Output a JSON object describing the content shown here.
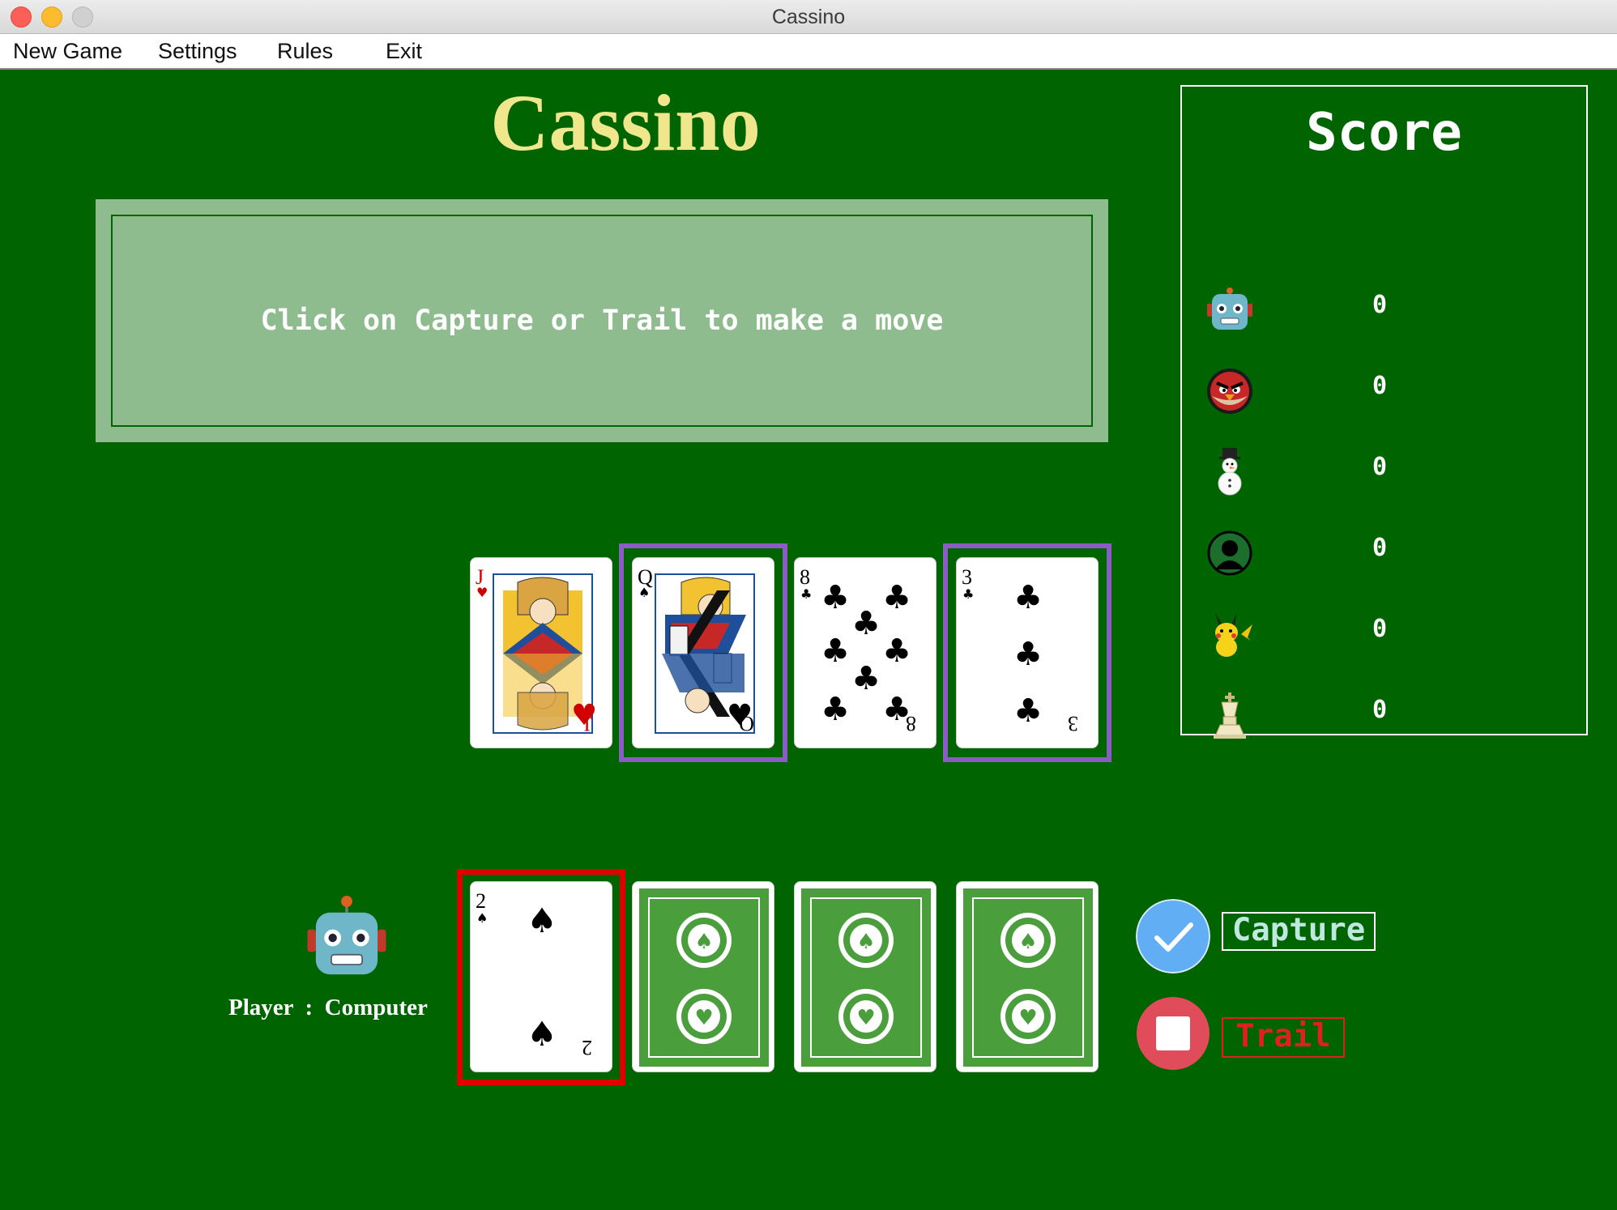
{
  "window": {
    "title": "Cassino"
  },
  "menu": {
    "items": [
      "New Game",
      "Settings",
      "Rules",
      "Exit"
    ]
  },
  "game": {
    "title": "Cassino"
  },
  "message": "Click on Capture or Trail to make a move",
  "score": {
    "title": "Score",
    "rows": [
      {
        "icon": "robot-icon",
        "value": "0"
      },
      {
        "icon": "angry-bird-icon",
        "value": "0"
      },
      {
        "icon": "snowman-icon",
        "value": "0"
      },
      {
        "icon": "silhouette-icon",
        "value": "0"
      },
      {
        "icon": "pikachu-icon",
        "value": "0"
      },
      {
        "icon": "chess-king-icon",
        "value": "0"
      }
    ]
  },
  "table_cards": [
    {
      "rank": "J",
      "suit": "hearts",
      "selected": false
    },
    {
      "rank": "Q",
      "suit": "spades",
      "selected": true
    },
    {
      "rank": "8",
      "suit": "clubs",
      "selected": false
    },
    {
      "rank": "3",
      "suit": "clubs",
      "selected": true
    }
  ],
  "player": {
    "name_label": "Player  :  Computer",
    "avatar": "robot-icon",
    "hand": [
      {
        "rank": "2",
        "suit": "spades",
        "face_up": true,
        "selected": true
      },
      {
        "face_up": false
      },
      {
        "face_up": false
      },
      {
        "face_up": false
      }
    ]
  },
  "actions": {
    "capture": "Capture",
    "trail": "Trail"
  },
  "colors": {
    "felt": "#006400",
    "title": "#f0e68c",
    "message_panel": "#8fbc8f",
    "selection_table": "#8a5cc4",
    "selection_hand": "#e10000",
    "card_back": "#4a9e3c",
    "capture_button": "#62aef4",
    "trail_button": "#e04c5a"
  }
}
